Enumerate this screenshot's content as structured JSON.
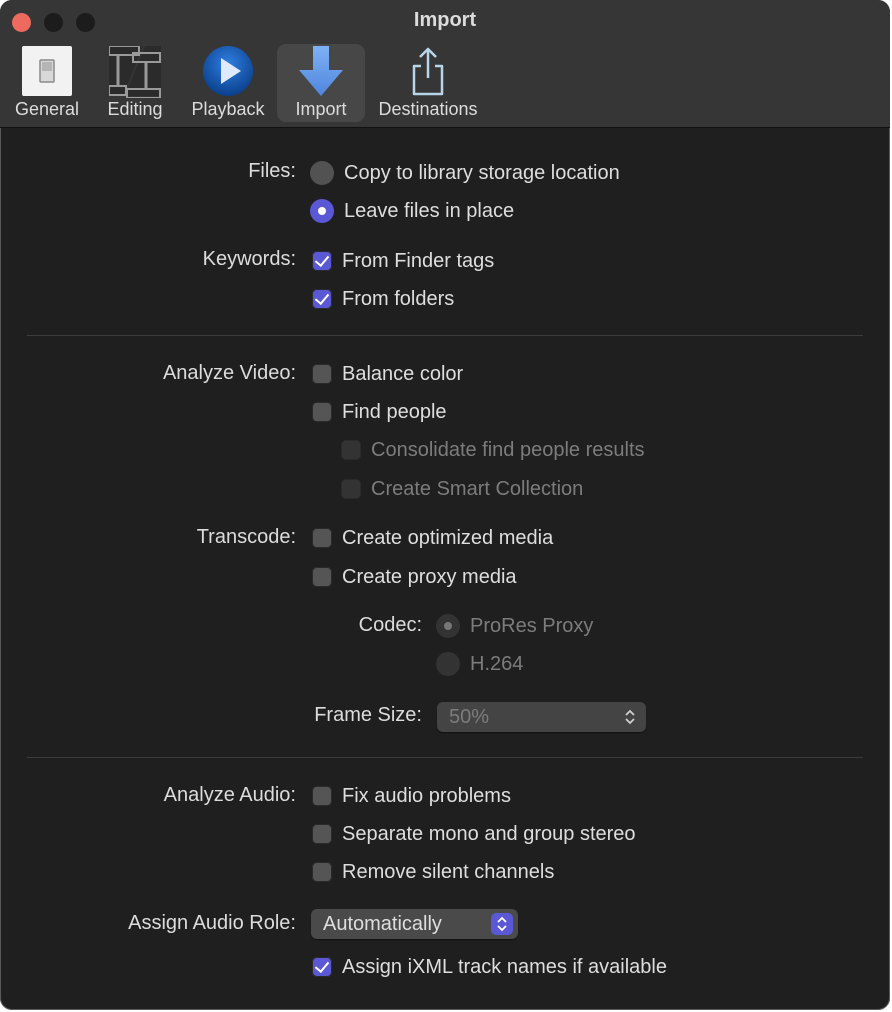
{
  "window": {
    "title": "Import"
  },
  "toolbar": {
    "items": [
      {
        "label": "General",
        "icon": "general-switch-icon",
        "active": false
      },
      {
        "label": "Editing",
        "icon": "film-strips-icon",
        "active": false
      },
      {
        "label": "Playback",
        "icon": "play-icon",
        "active": false
      },
      {
        "label": "Import",
        "icon": "import-arrow-icon",
        "active": true
      },
      {
        "label": "Destinations",
        "icon": "share-icon",
        "active": false
      }
    ]
  },
  "files": {
    "label": "Files:",
    "options": [
      {
        "label": "Copy to library storage location",
        "selected": false
      },
      {
        "label": "Leave files in place",
        "selected": true
      }
    ]
  },
  "keywords": {
    "label": "Keywords:",
    "options": [
      {
        "label": "From Finder tags",
        "checked": true
      },
      {
        "label": "From folders",
        "checked": true
      }
    ]
  },
  "analyze_video": {
    "label": "Analyze Video:",
    "options": [
      {
        "label": "Balance color",
        "checked": false,
        "enabled": true
      },
      {
        "label": "Find people",
        "checked": false,
        "enabled": true
      },
      {
        "label": "Consolidate find people results",
        "checked": false,
        "enabled": false
      },
      {
        "label": "Create Smart Collection",
        "checked": false,
        "enabled": false
      }
    ]
  },
  "transcode": {
    "label": "Transcode:",
    "options": [
      {
        "label": "Create optimized media",
        "checked": false
      },
      {
        "label": "Create proxy media",
        "checked": false
      }
    ],
    "codec": {
      "label": "Codec:",
      "options": [
        {
          "label": "ProRes Proxy",
          "selected": true,
          "enabled": false
        },
        {
          "label": "H.264",
          "selected": false,
          "enabled": false
        }
      ]
    },
    "frame_size": {
      "label": "Frame Size:",
      "value": "50%",
      "enabled": false
    }
  },
  "analyze_audio": {
    "label": "Analyze Audio:",
    "options": [
      {
        "label": "Fix audio problems",
        "checked": false
      },
      {
        "label": "Separate mono and group stereo",
        "checked": false
      },
      {
        "label": "Remove silent channels",
        "checked": false
      }
    ]
  },
  "audio_role": {
    "label": "Assign Audio Role:",
    "value": "Automatically",
    "ixml": {
      "label": "Assign iXML track names if available",
      "checked": true
    }
  },
  "colors": {
    "accent": "#5b58d6",
    "close": "#ec6a5e",
    "background": "#1f1f1f",
    "toolbar": "#363636"
  }
}
